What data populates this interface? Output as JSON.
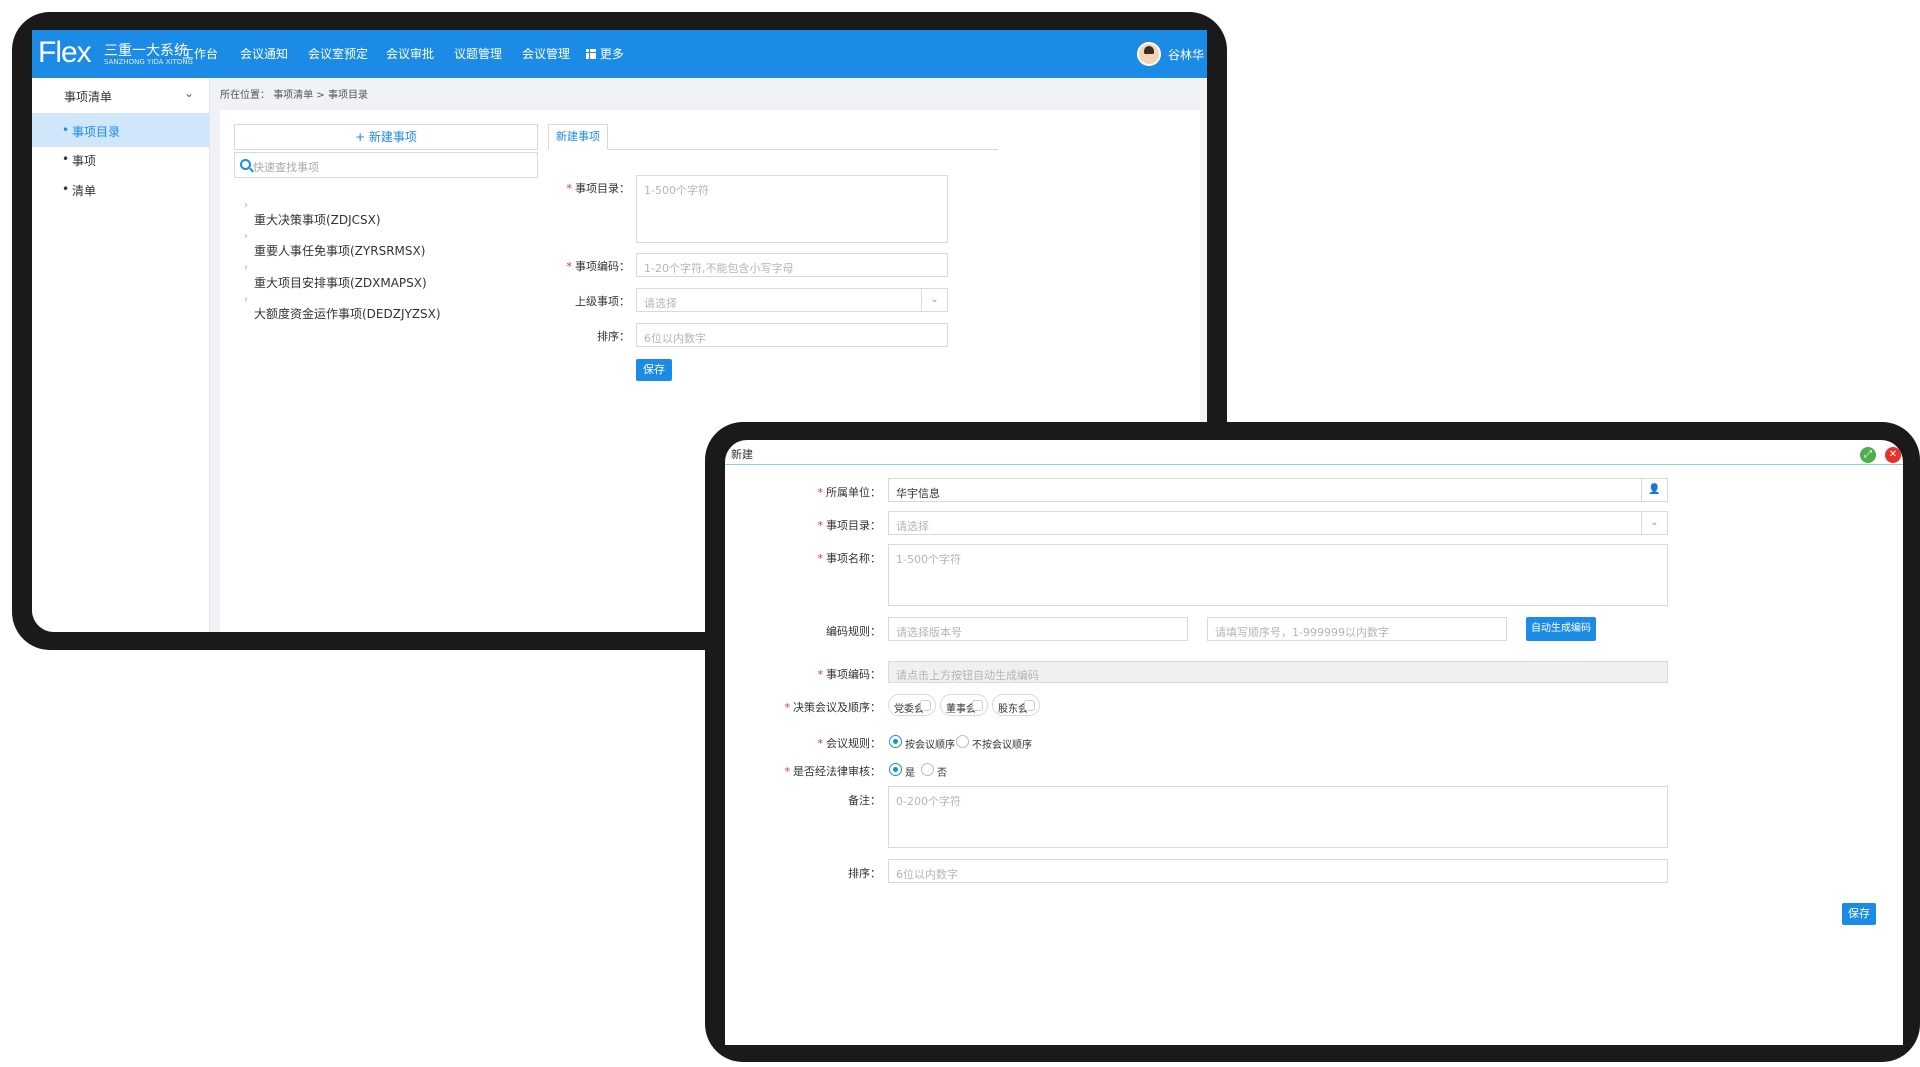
{
  "app": {
    "logo_text": "Flex",
    "logo_cn": "三重一大系统",
    "logo_en": "SANZHONG YIDA XITONG",
    "nav": [
      "工作台",
      "会议通知",
      "会议室预定",
      "会议审批",
      "议题管理",
      "会议管理",
      "更多"
    ],
    "user_name": "谷林华"
  },
  "sidebar": {
    "header": "事项清单",
    "items": [
      {
        "label": "事项目录"
      },
      {
        "label": "事项"
      },
      {
        "label": "清单"
      }
    ]
  },
  "breadcrumb": {
    "prefix": "所在位置：",
    "path1": "事项清单",
    "sep": ">",
    "path2": "事项目录"
  },
  "left_panel": {
    "new_button": "+ 新建事项",
    "search_placeholder": "快速查找事项",
    "tree": [
      "重大决策事项(ZDJCSX)",
      "重要人事任免事项(ZYRSRMSX)",
      "重大项目安排事项(ZDXMAPSX)",
      "大额度资金运作事项(DEDZJYZSX)"
    ]
  },
  "right_form": {
    "tab": "新建事项",
    "catalog_label": "事项目录：",
    "catalog_ph": "1-500个字符",
    "code_label": "事项编码：",
    "code_ph": "1-20个字符,不能包含小写字母",
    "parent_label": "上级事项：",
    "parent_ph": "请选择",
    "order_label": "排序：",
    "order_ph": "6位以内数字",
    "save": "保存"
  },
  "dialog": {
    "title": "新建",
    "unit_label": "所属单位：",
    "unit_value": "华宇信息",
    "catalog_label": "事项目录：",
    "catalog_ph": "请选择",
    "name_label": "事项名称：",
    "name_ph": "1-500个字符",
    "rule_label": "编码规则：",
    "rule_ph1": "请选择版本号",
    "rule_ph2": "请填写顺序号，1-999999以内数字",
    "auto_btn": "自动生成编码",
    "code_label": "事项编码：",
    "code_ph": "请点击上方按钮自动生成编码",
    "meeting_label": "决策会议及顺序：",
    "meetings": [
      "党委会",
      "董事会",
      "股东会"
    ],
    "rule2_label": "会议规则：",
    "rule2_opts": [
      "按会议顺序",
      "不按会议顺序"
    ],
    "legal_label": "是否经法律审核：",
    "legal_opts": [
      "是",
      "否"
    ],
    "remark_label": "备注：",
    "remark_ph": "0-200个字符",
    "order_label": "排序：",
    "order_ph": "6位以内数字",
    "save": "保存"
  },
  "colors": {
    "accent": "#1c8be6",
    "required": "#e5322c",
    "close": "#e5322c",
    "restore": "#4cae4c"
  },
  "icons": {
    "more": "grid-icon",
    "search": "search-icon",
    "person": "person-icon",
    "dropdown": "chevron-down-icon"
  }
}
